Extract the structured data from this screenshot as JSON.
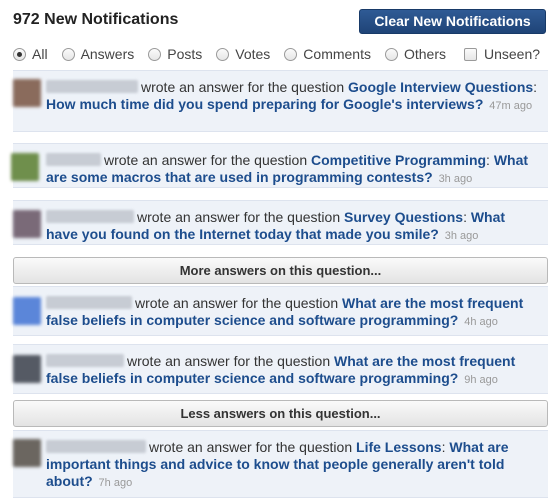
{
  "header": {
    "title": "972 New Notifications",
    "clear_button": "Clear New Notifications"
  },
  "filters": [
    {
      "label": "All",
      "checked": true
    },
    {
      "label": "Answers",
      "checked": false
    },
    {
      "label": "Posts",
      "checked": false
    },
    {
      "label": "Votes",
      "checked": false
    },
    {
      "label": "Comments",
      "checked": false
    },
    {
      "label": "Others",
      "checked": false
    }
  ],
  "unseen_label": "Unseen?",
  "notifications": [
    {
      "action": "wrote an answer for the question",
      "topic": "Google Interview Questions",
      "question": "How much time did you spend preparing for Google's interviews?",
      "time": "47m ago"
    },
    {
      "action": "wrote an answer for the question",
      "topic": "Competitive Programming",
      "question": "What are some macros that are used in programming contests?",
      "time": "3h ago"
    },
    {
      "action": "wrote an answer for the question",
      "topic": "Survey Questions",
      "question": "What have you found on the Internet today that made you smile?",
      "time": "3h ago"
    },
    {
      "action": "wrote an answer for the question",
      "topic": "",
      "question": "What are the most frequent false beliefs in computer science and software programming?",
      "time": "4h ago"
    },
    {
      "action": "wrote an answer for the question",
      "topic": "",
      "question": "What are the most frequent false beliefs in computer science and software programming?",
      "time": "9h ago"
    },
    {
      "action": "wrote an answer for the question",
      "topic": "Life Lessons",
      "question": "What are important things and advice to know that people generally aren't told about?",
      "time": "7h ago"
    }
  ],
  "more_answers_label": "More answers on this question...",
  "less_answers_label": "Less answers on this question...",
  "colors": {
    "button": "#1f4477",
    "link": "#1d4d8d",
    "row_bg": "#eef2f8"
  }
}
